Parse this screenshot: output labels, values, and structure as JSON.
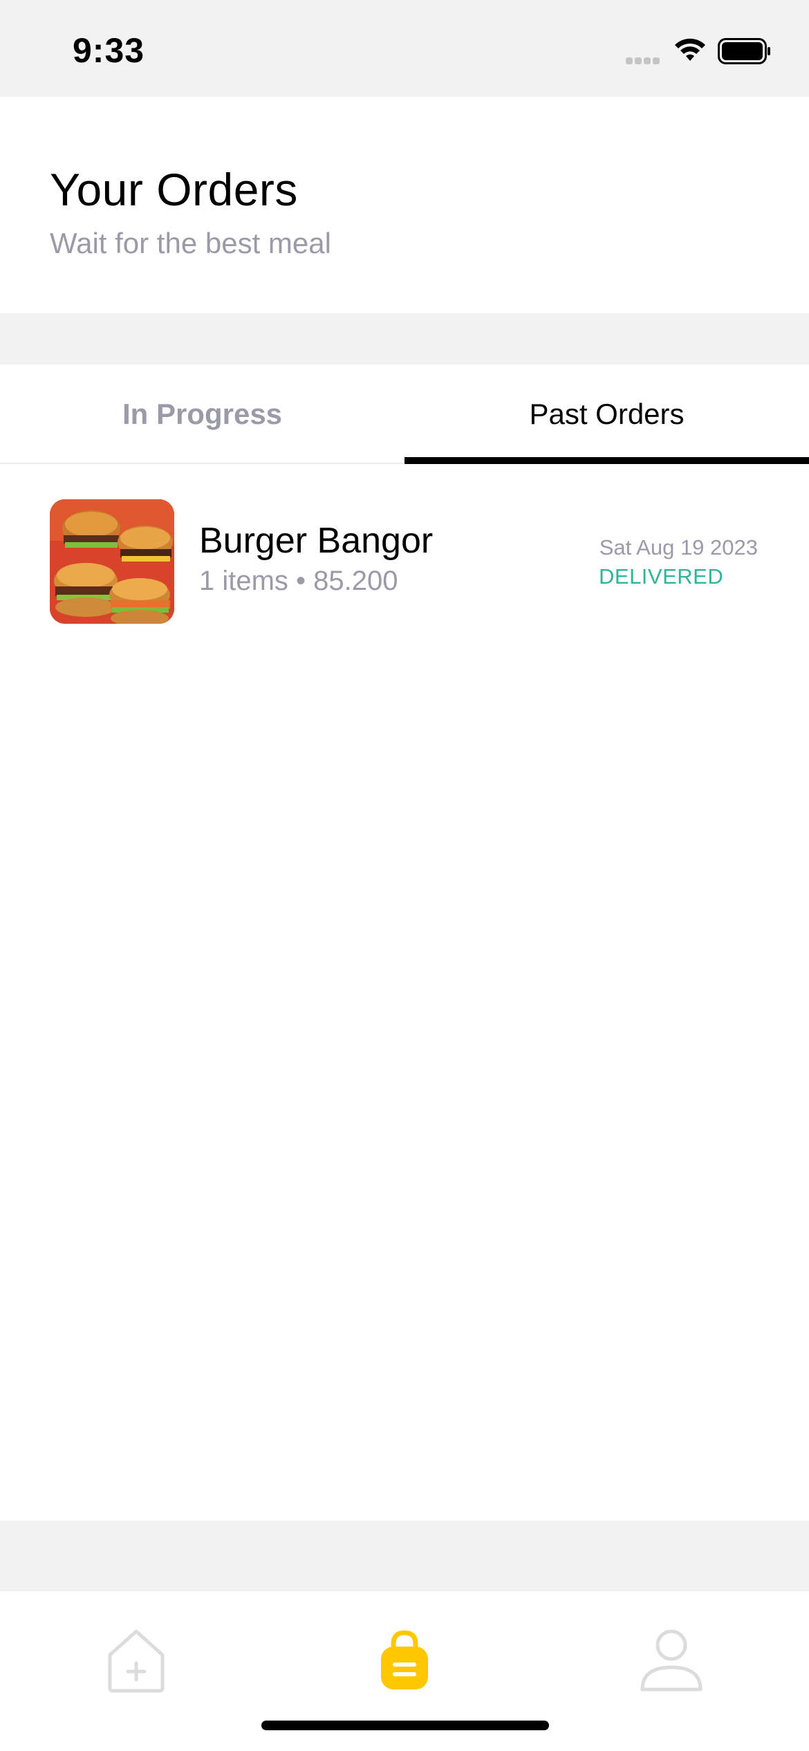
{
  "status_bar": {
    "time": "9:33",
    "icons": [
      "signal-icon",
      "wifi-icon",
      "battery-icon"
    ]
  },
  "header": {
    "title": "Your Orders",
    "subtitle": "Wait for the best meal"
  },
  "tabs": [
    {
      "label": "In Progress",
      "active": false
    },
    {
      "label": "Past Orders",
      "active": true
    }
  ],
  "orders": [
    {
      "name": "Burger Bangor",
      "meta": "1 items • 85.200",
      "date": "Sat Aug 19 2023",
      "status": "DELIVERED",
      "image": "burger-photo"
    }
  ],
  "bottom_nav": {
    "items": [
      {
        "icon": "home-add-icon",
        "active": false
      },
      {
        "icon": "shopping-bag-icon",
        "active": true
      },
      {
        "icon": "profile-icon",
        "active": false
      }
    ]
  },
  "colors": {
    "accent": "#FFC700",
    "status_delivered": "#2BB59A",
    "muted_text": "#9A9AA8",
    "band_gray": "#F2F2F2"
  }
}
